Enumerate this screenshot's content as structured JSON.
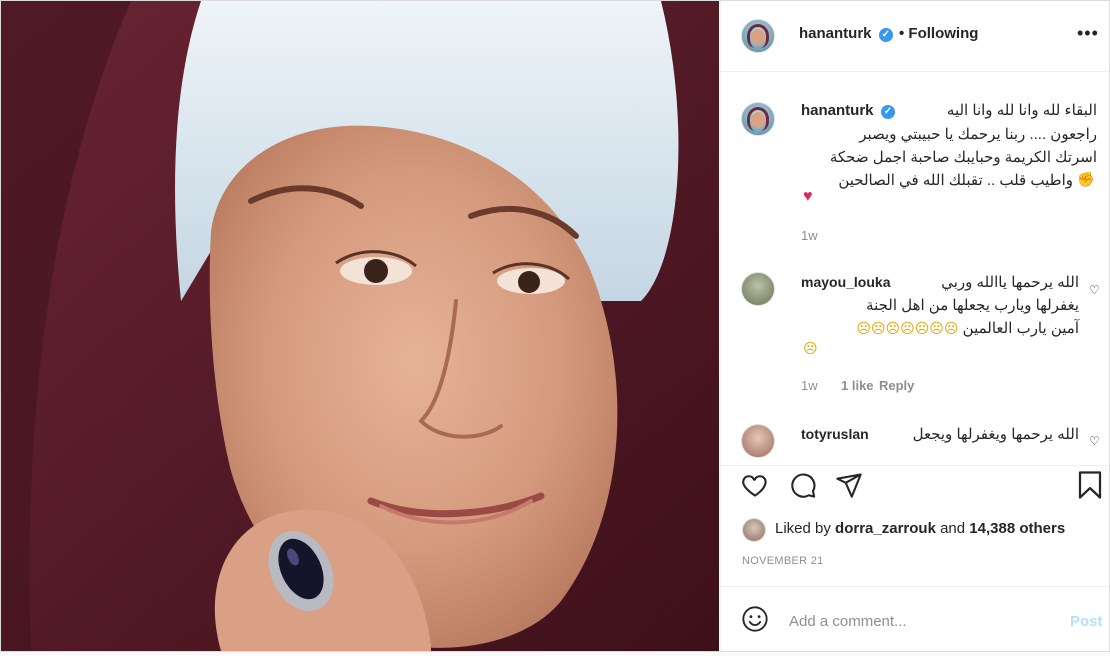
{
  "post": {
    "username": "hananturk",
    "verified_mark": "✓",
    "follow_status": "• Following",
    "more_label": "•••"
  },
  "caption": {
    "username": "hananturk",
    "lines": [
      "البقاء لله وانا لله وانا اليه",
      "راجعون .... ربنا يرحمك يا حبيبتي ويصبر",
      "اسرتك الكريمة وحبايبك صاحبة اجمل ضحكة",
      "واطيب قلب .. تقبلك الله في الصالحين"
    ],
    "time": "1w"
  },
  "comments": [
    {
      "username": "mayou_louka",
      "lines": [
        "الله يرحمها ياالله وربي",
        "يغفرلها ويارب يجعلها من اهل الجنة",
        "آمين يارب العالمين"
      ],
      "time": "1w",
      "likes": "1 like",
      "reply": "Reply"
    },
    {
      "username": "totyruslan",
      "lines": [
        "الله يرحمها ويغفرلها ويجعل"
      ]
    }
  ],
  "likes": {
    "prefix": "Liked by",
    "user": "dorra_zarrouk",
    "middle": "and",
    "others": "14,388 others"
  },
  "date": "NOVEMBER 21",
  "add_comment": {
    "placeholder": "Add a comment...",
    "post_label": "Post"
  },
  "icons": [
    "heart-icon",
    "comment-icon",
    "share-icon",
    "bookmark-icon",
    "emoji-icon"
  ],
  "colors": {
    "verified": "#3897f0",
    "post_disabled": "#b2dffc",
    "scarf": "#5c1f2d",
    "hijab": "#d9e8f2"
  }
}
